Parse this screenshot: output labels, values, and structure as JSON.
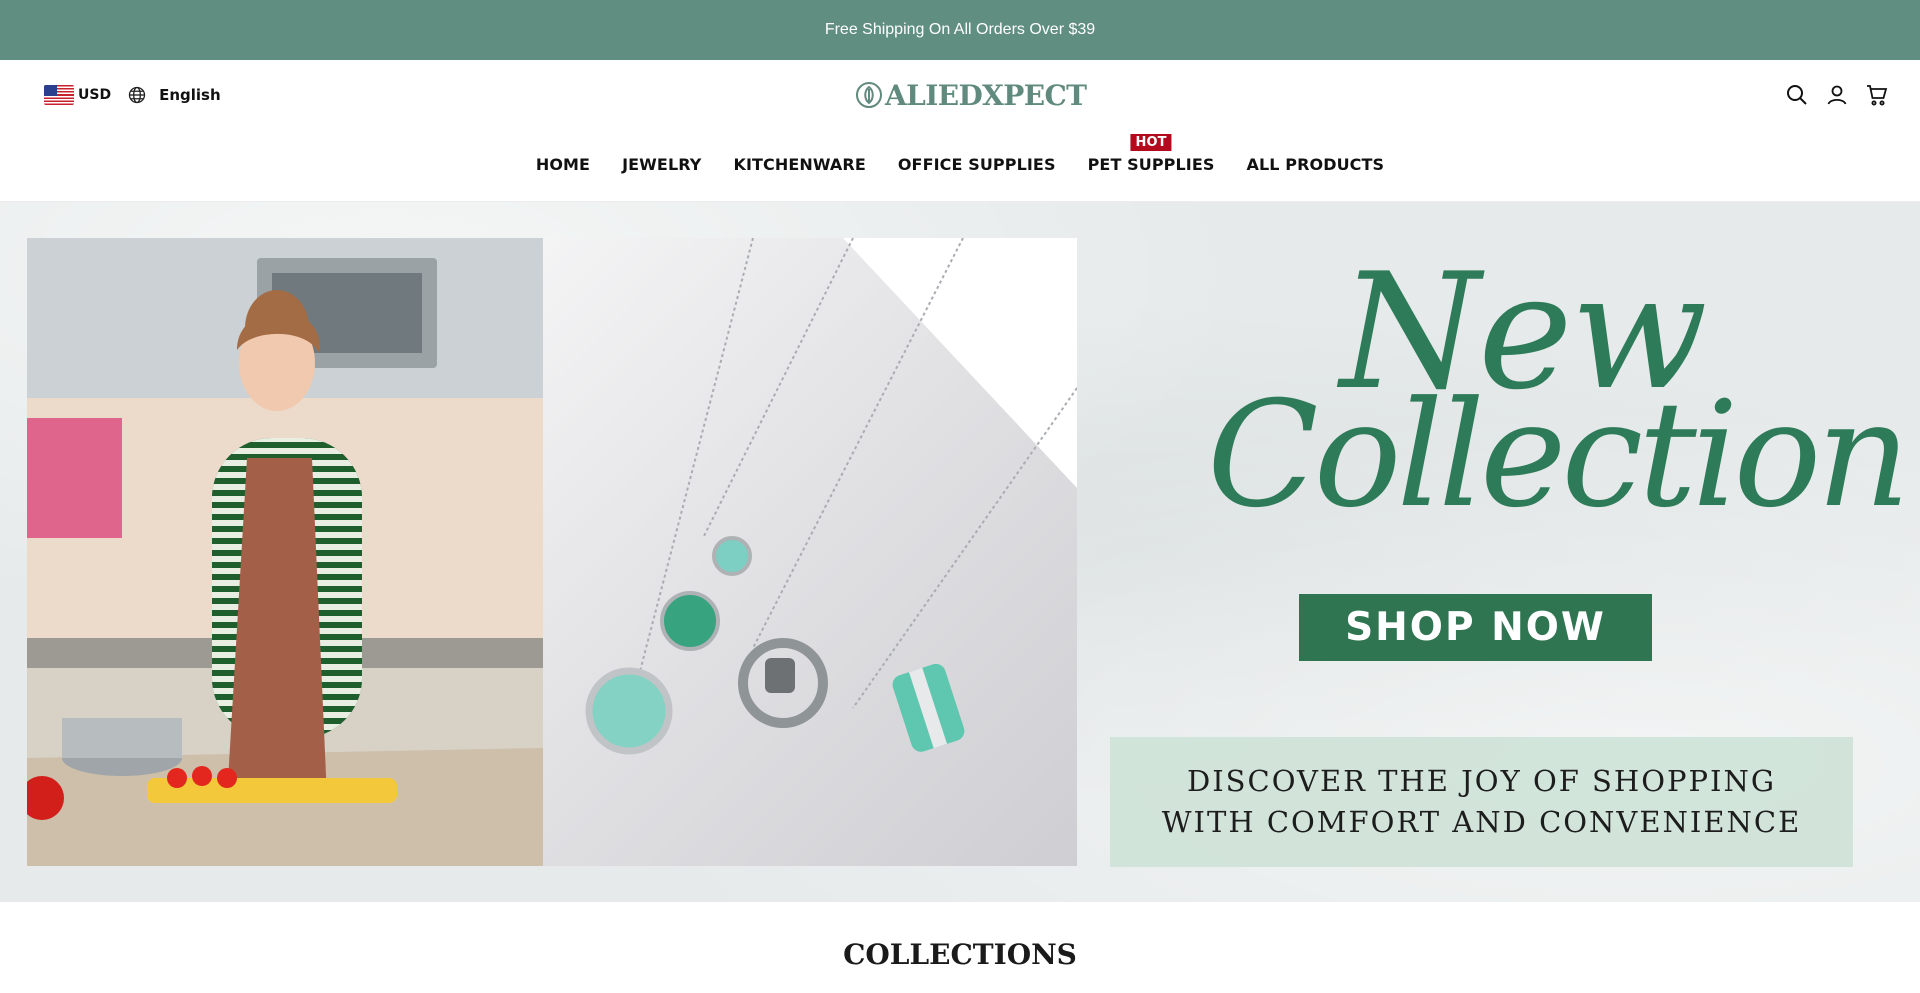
{
  "announcement": "Free Shipping On All Orders Over $39",
  "header": {
    "currency": "USD",
    "language": "English",
    "brand": "ALIEDXPECT"
  },
  "nav": {
    "items": [
      {
        "label": "HOME"
      },
      {
        "label": "JEWELRY"
      },
      {
        "label": "KITCHENWARE"
      },
      {
        "label": "OFFICE SUPPLIES"
      },
      {
        "label": "PET SUPPLIES",
        "badge": "HOT"
      },
      {
        "label": "ALL PRODUCTS"
      }
    ]
  },
  "hero": {
    "headline_line1": "New",
    "headline_line2": "Collection",
    "cta": "SHOP NOW",
    "tagline_line1": "DISCOVER THE JOY OF SHOPPING",
    "tagline_line2": "WITH COMFORT AND CONVENIENCE"
  },
  "section_title": "COLLECTIONS",
  "colors": {
    "announcement_bg": "#608e80",
    "brand_green": "#2d7b59",
    "cta_bg": "#2f7552",
    "hot_badge": "#b30a1d"
  },
  "icons": [
    "flag-us-icon",
    "globe-icon",
    "logo-emblem-icon",
    "search-icon",
    "account-icon",
    "cart-icon"
  ]
}
